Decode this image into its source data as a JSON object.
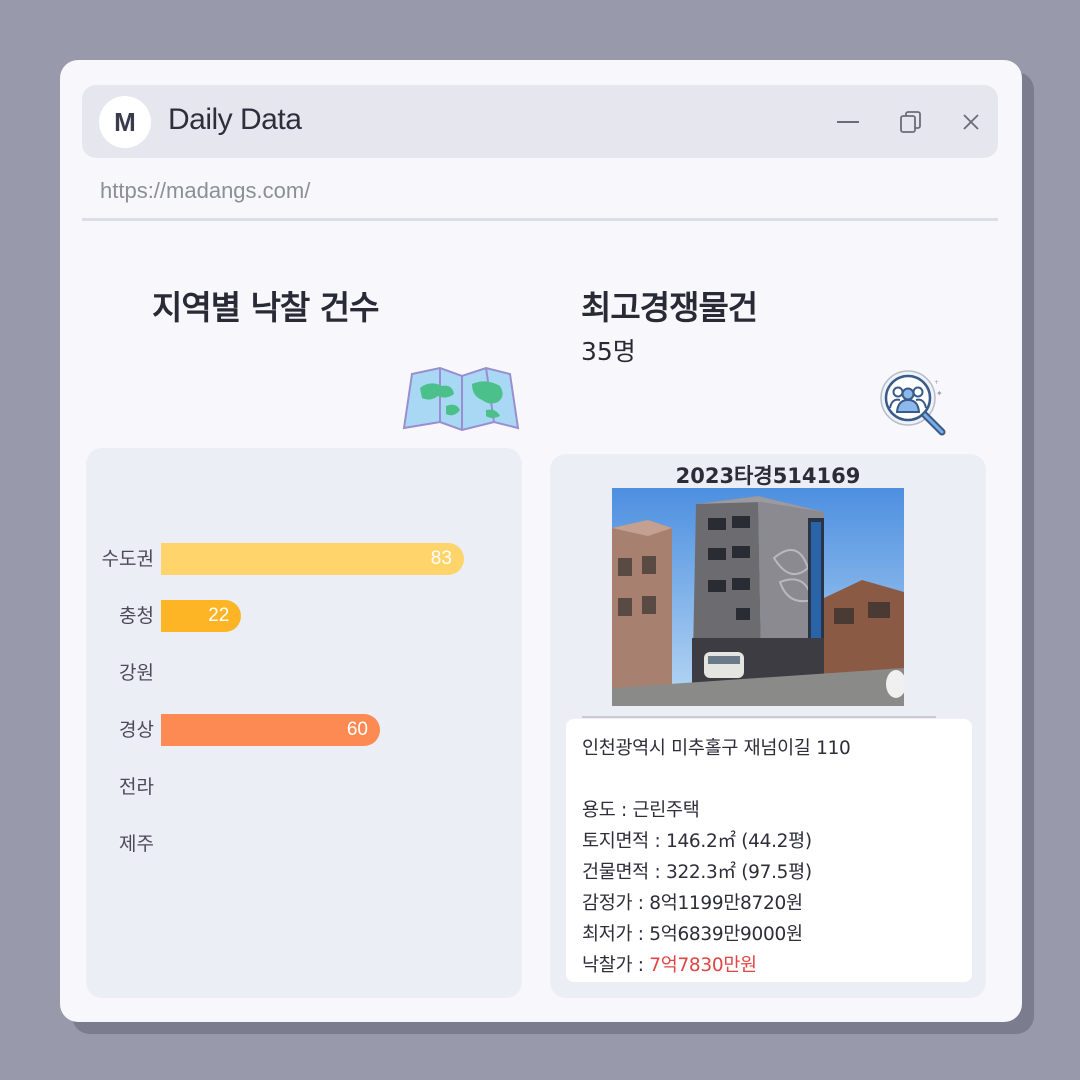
{
  "window": {
    "logo_letter": "M",
    "title": "Daily Data",
    "url": "https://madangs.com/",
    "controls": [
      "minimize-icon",
      "restore-icon",
      "close-icon"
    ]
  },
  "left": {
    "heading": "지역별 낙찰 건수",
    "icon": "map-icon"
  },
  "right": {
    "heading": "최고경쟁물건",
    "competitors": "35명",
    "icon": "people-search-icon"
  },
  "chart_data": {
    "type": "bar",
    "orientation": "horizontal",
    "categories": [
      "수도권",
      "충청",
      "강원",
      "경상",
      "전라",
      "제주"
    ],
    "values": [
      83,
      22,
      0,
      60,
      0,
      0
    ],
    "value_labels": [
      "83",
      "22",
      "",
      "60",
      "",
      ""
    ],
    "colors": [
      "#ffd46a",
      "#fdb525",
      "#f7a7a0",
      "#fc8a52",
      "#a8c8f0",
      "#b8e0b0"
    ],
    "xlim": [
      0,
      100
    ],
    "grid": false
  },
  "property": {
    "case_number": "2023타경514169",
    "address": "인천광역시 미추홀구 재넘이길 110",
    "usage_label": "용도 : ",
    "usage": "근린주택",
    "land_area_label": "토지면적 : ",
    "land_area": "146.2㎡ (44.2평)",
    "building_area_label": "건물면적 : ",
    "building_area": "322.3㎡ (97.5평)",
    "appraisal_label": "감정가 : ",
    "appraisal": "8억1199만8720원",
    "minimum_label": "최저가 : ",
    "minimum": "5억6839만9000원",
    "winning_label": "낙찰가 : ",
    "winning": "7억7830만원",
    "winning_color": "#e04545"
  }
}
